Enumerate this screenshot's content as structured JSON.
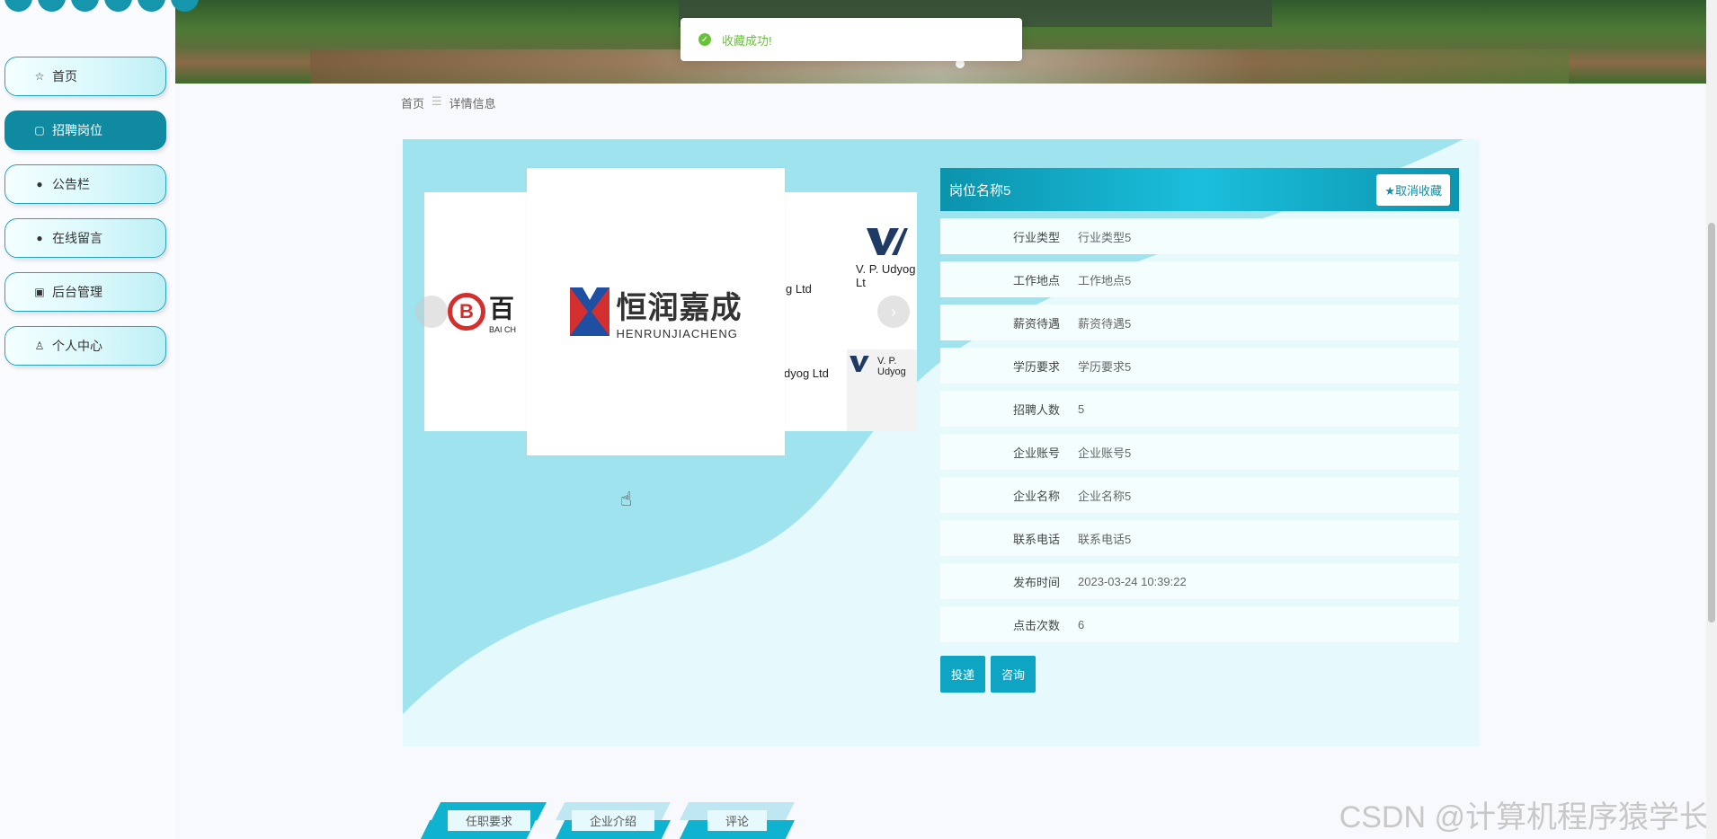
{
  "sidebar": {
    "items": [
      {
        "label": "首页",
        "icon": "star-icon",
        "glyph": "☆"
      },
      {
        "label": "招聘岗位",
        "icon": "bag-icon",
        "glyph": "▢"
      },
      {
        "label": "公告栏",
        "icon": "alert-icon",
        "glyph": "●"
      },
      {
        "label": "在线留言",
        "icon": "question-icon",
        "glyph": "●"
      },
      {
        "label": "后台管理",
        "icon": "gift-icon",
        "glyph": "▣"
      },
      {
        "label": "个人中心",
        "icon": "user-icon",
        "glyph": "♙"
      }
    ]
  },
  "toast": {
    "message": "收藏成功!"
  },
  "breadcrumb": {
    "home": "首页",
    "separator": "☰",
    "current": "详情信息"
  },
  "carousel": {
    "logo_bc": {
      "cn": "百",
      "sub": "BAI CH"
    },
    "logo_hr": {
      "cn": "恒润嘉成",
      "en": "HENRUNJIACHENG"
    },
    "vp_text_1": "V. P. Udyog Lt",
    "vp_text_2": "dyog Ltd",
    "vp_text_3": "g Ltd",
    "vp_text_4": "V. P. Udyog",
    "next_arrow": "›"
  },
  "detail": {
    "title": "岗位名称5",
    "unfavorite_label": "★取消收藏",
    "rows": [
      {
        "label": "行业类型",
        "value": "行业类型5"
      },
      {
        "label": "工作地点",
        "value": "工作地点5"
      },
      {
        "label": "薪资待遇",
        "value": "薪资待遇5"
      },
      {
        "label": "学历要求",
        "value": "学历要求5"
      },
      {
        "label": "招聘人数",
        "value": "5"
      },
      {
        "label": "企业账号",
        "value": "企业账号5"
      },
      {
        "label": "企业名称",
        "value": "企业名称5"
      },
      {
        "label": "联系电话",
        "value": "联系电话5"
      },
      {
        "label": "发布时间",
        "value": "2023-03-24 10:39:22"
      },
      {
        "label": "点击次数",
        "value": "6"
      }
    ],
    "apply_label": "投递",
    "consult_label": "咨询"
  },
  "tabs": [
    "任职要求",
    "企业介绍",
    "评论"
  ],
  "watermark": "CSDN @计算机程序猿学长",
  "colors": {
    "accent": "#0f8aa0",
    "success": "#67c23a",
    "panel_bg": "#e6f9fc",
    "wave": "#9fe3ef"
  }
}
